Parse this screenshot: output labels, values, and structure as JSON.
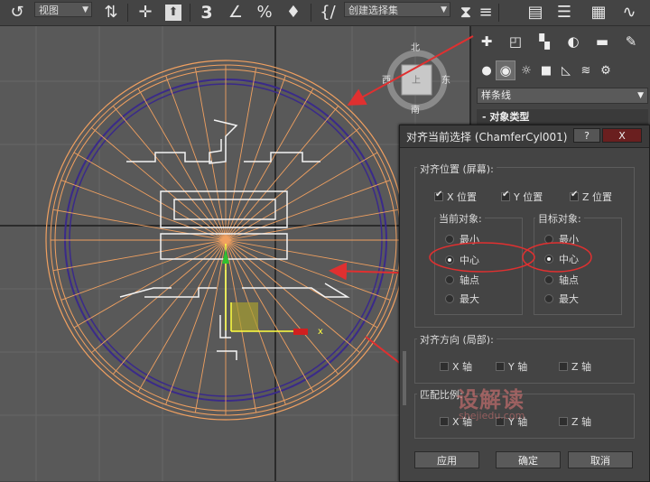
{
  "toolbar": {
    "view_select": "视图",
    "snap_label": "3",
    "selection_set": "创建选择集"
  },
  "viewcube": {
    "north": "北",
    "west": "西",
    "east": "东",
    "south": "南",
    "face": "上"
  },
  "gizmo": {
    "axis_x": "x"
  },
  "command_panel": {
    "category_select": "样条线",
    "rollout_title": "对象类型"
  },
  "dialog": {
    "title": "对齐当前选择 (ChamferCyl001)",
    "help_label": "?",
    "close_label": "X",
    "align_position": {
      "label": "对齐位置 (屏幕):",
      "x": {
        "label": "X 位置",
        "checked": true
      },
      "y": {
        "label": "Y 位置",
        "checked": true
      },
      "z": {
        "label": "Z 位置",
        "checked": true
      }
    },
    "current_object": {
      "label": "当前对象:",
      "options": [
        "最小",
        "中心",
        "轴点",
        "最大"
      ],
      "selected": "中心"
    },
    "target_object": {
      "label": "目标对象:",
      "options": [
        "最小",
        "中心",
        "轴点",
        "最大"
      ],
      "selected": "中心"
    },
    "align_orientation": {
      "label": "对齐方向 (局部):",
      "x": "X 轴",
      "y": "Y 轴",
      "z": "Z 轴"
    },
    "match_scale": {
      "label": "匹配比例:",
      "x": "X 轴",
      "y": "Y 轴",
      "z": "Z 轴"
    },
    "apply_label": "应用",
    "ok_label": "确定",
    "cancel_label": "取消"
  },
  "watermark": {
    "main": "设解读",
    "sub": "shejiedu.com"
  },
  "colors": {
    "background": "#444444",
    "viewport": "#595959",
    "wire_orange": "#f0a060",
    "wire_purple": "#3a2a8a",
    "annotation_red": "#e03030"
  }
}
